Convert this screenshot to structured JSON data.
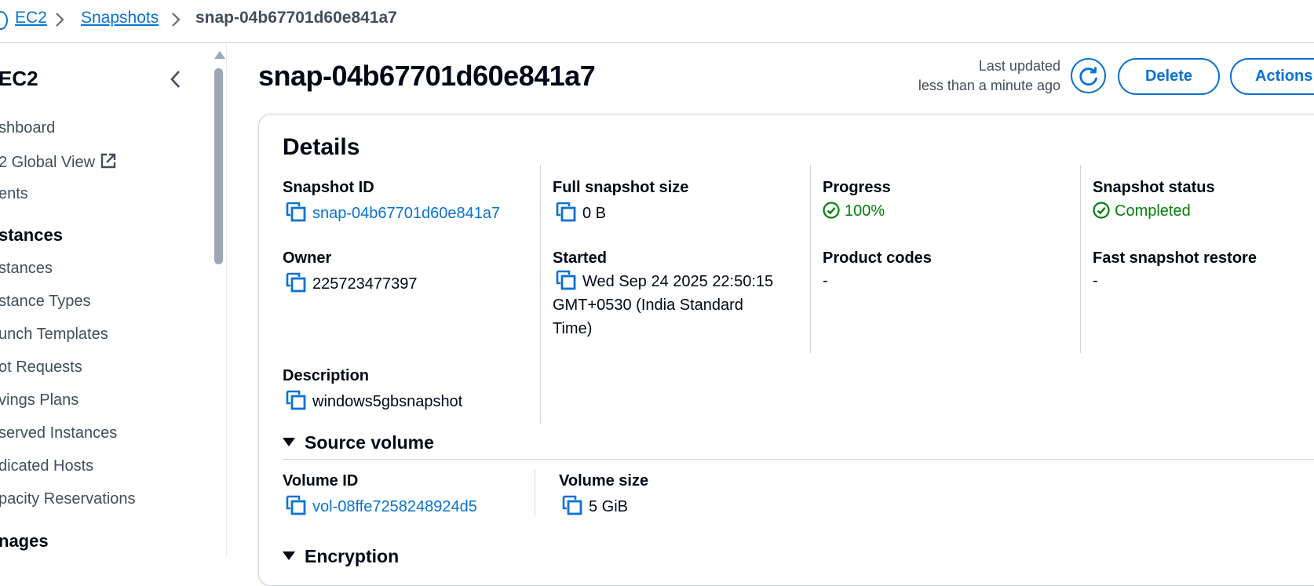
{
  "breadcrumb": {
    "items": [
      "EC2",
      "Snapshots"
    ],
    "current": "snap-04b67701d60e841a7"
  },
  "sidebar": {
    "title": "EC2",
    "items_top": [
      "shboard",
      "2 Global View",
      "ents"
    ],
    "section_instances": "stances",
    "instances_items": [
      "stances",
      "stance Types",
      "unch Templates",
      "ot Requests",
      "vings Plans",
      "served Instances",
      "dicated Hosts",
      "pacity Reservations"
    ],
    "section_images": "nages"
  },
  "header": {
    "title": "snap-04b67701d60e841a7",
    "last_updated_label": "Last updated",
    "last_updated_value": "less than a minute ago",
    "delete_label": "Delete",
    "actions_label": "Actions"
  },
  "details": {
    "title": "Details",
    "snapshot_id_label": "Snapshot ID",
    "snapshot_id": "snap-04b67701d60e841a7",
    "full_size_label": "Full snapshot size",
    "full_size": "0 B",
    "progress_label": "Progress",
    "progress": "100%",
    "status_label": "Snapshot status",
    "status": "Completed",
    "owner_label": "Owner",
    "owner": "225723477397",
    "started_label": "Started",
    "started_line1": "Wed Sep 24 2025 22:50:15",
    "started_line2": "GMT+0530 (India Standard",
    "started_line3": "Time)",
    "product_codes_label": "Product codes",
    "product_codes": "-",
    "fsr_label": "Fast snapshot restore",
    "fsr": "-",
    "description_label": "Description",
    "description": "windows5gbsnapshot"
  },
  "source_volume": {
    "title": "Source volume",
    "volume_id_label": "Volume ID",
    "volume_id": "vol-08ffe7258248924d5",
    "volume_size_label": "Volume size",
    "volume_size": "5 GiB"
  },
  "encryption": {
    "title": "Encryption"
  },
  "colors": {
    "link": "#0972d3",
    "success": "#037f0c",
    "text": "#000716",
    "border": "#d1d5db"
  }
}
